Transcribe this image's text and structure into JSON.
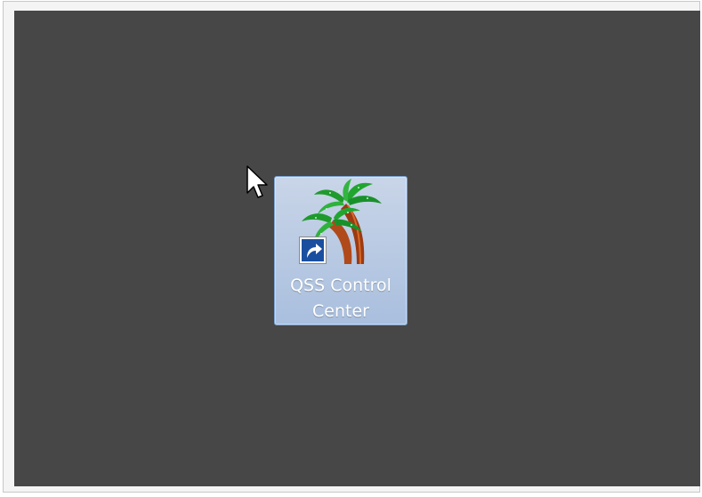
{
  "desktop": {
    "background_color": "#474747",
    "icons": [
      {
        "label_line1": "QSS Control",
        "label_line2": "Center",
        "icon": "palm-tree-icon",
        "shortcut_overlay": "shortcut-arrow-icon",
        "selected": true
      }
    ]
  },
  "cursor": {
    "icon": "mouse-pointer-icon"
  }
}
